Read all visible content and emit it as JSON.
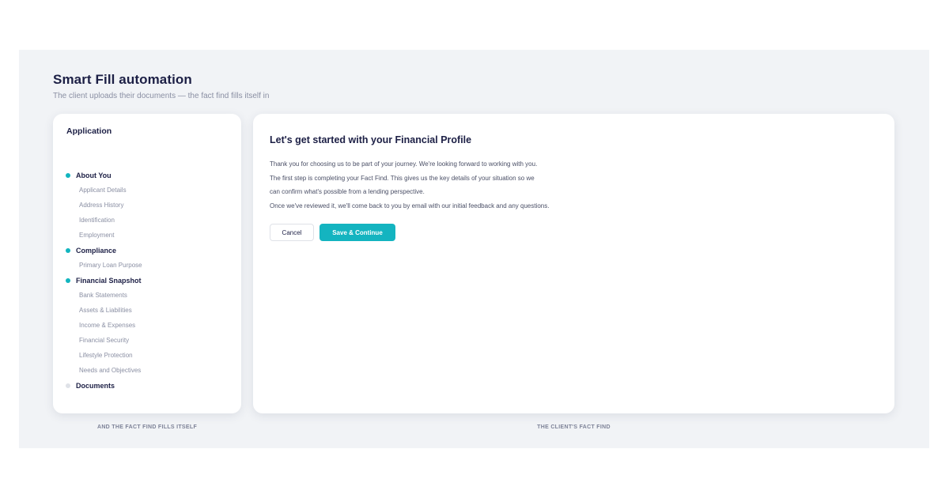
{
  "header": {
    "title": "Smart Fill automation",
    "subtitle": "The client uploads their documents — the fact find fills itself in"
  },
  "sidebar": {
    "title": "Application",
    "sections": [
      {
        "label": "About You",
        "status": "active",
        "items": [
          "Applicant Details",
          "Address History",
          "Identification",
          "Employment"
        ]
      },
      {
        "label": "Compliance",
        "status": "active",
        "items": [
          "Primary Loan Purpose"
        ]
      },
      {
        "label": "Financial Snapshot",
        "status": "active",
        "items": [
          "Bank Statements",
          "Assets & Liabilities",
          "Income & Expenses",
          "Financial Security",
          "Lifestyle Protection",
          "Needs and Objectives"
        ]
      },
      {
        "label": "Documents",
        "status": "pending",
        "items": []
      }
    ]
  },
  "main": {
    "title": "Let's get started with your Financial Profile",
    "paragraphs": [
      "Thank you for choosing us to be part of your journey. We're looking forward to working with you.",
      "The first step is completing your Fact Find. This gives us the key details of your situation so we",
      "can confirm what's possible from a lending perspective.",
      "Once we've reviewed it, we'll come back to you by email with our initial feedback and any questions."
    ],
    "cancel_label": "Cancel",
    "continue_label": "Save & Continue"
  },
  "captions": {
    "left": "AND THE FACT FIND FILLS ITSELF",
    "right": "THE CLIENT'S FACT FIND"
  },
  "colors": {
    "accent": "#14b4c0",
    "heading": "#1c1f45",
    "muted": "#8a8fa3",
    "background": "#f1f3f6",
    "pending_dot": "#dfe2e8"
  }
}
